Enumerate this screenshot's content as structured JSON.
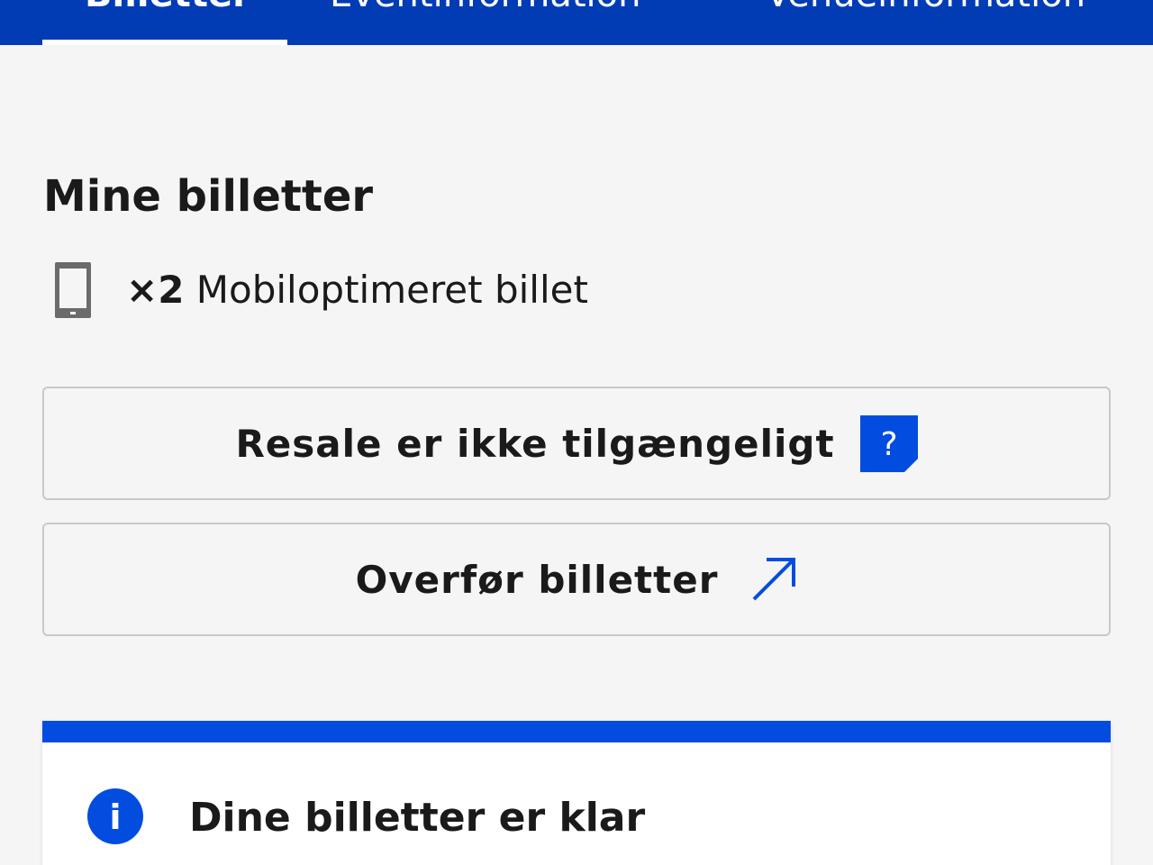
{
  "tabs": [
    {
      "label": "Billetter",
      "active": true
    },
    {
      "label": "Eventinformation",
      "active": false
    },
    {
      "label": "Venueinformation",
      "active": false
    }
  ],
  "section": {
    "title": "Mine billetter"
  },
  "ticket": {
    "icon": "mobile-phone-icon",
    "count": "×2",
    "type": "Mobiloptimeret billet"
  },
  "buttons": {
    "resale_label": "Resale er ikke tilgængeligt",
    "resale_help_icon": "question-mark-icon",
    "help_glyph": "?",
    "transfer_label": "Overfør billetter",
    "transfer_icon": "arrow-up-right-icon"
  },
  "info": {
    "icon": "info-icon",
    "glyph": "i",
    "message": "Dine billetter er klar"
  },
  "colors": {
    "header_bg": "#023cb5",
    "accent": "#024ddf",
    "page_bg": "#f5f5f5"
  }
}
